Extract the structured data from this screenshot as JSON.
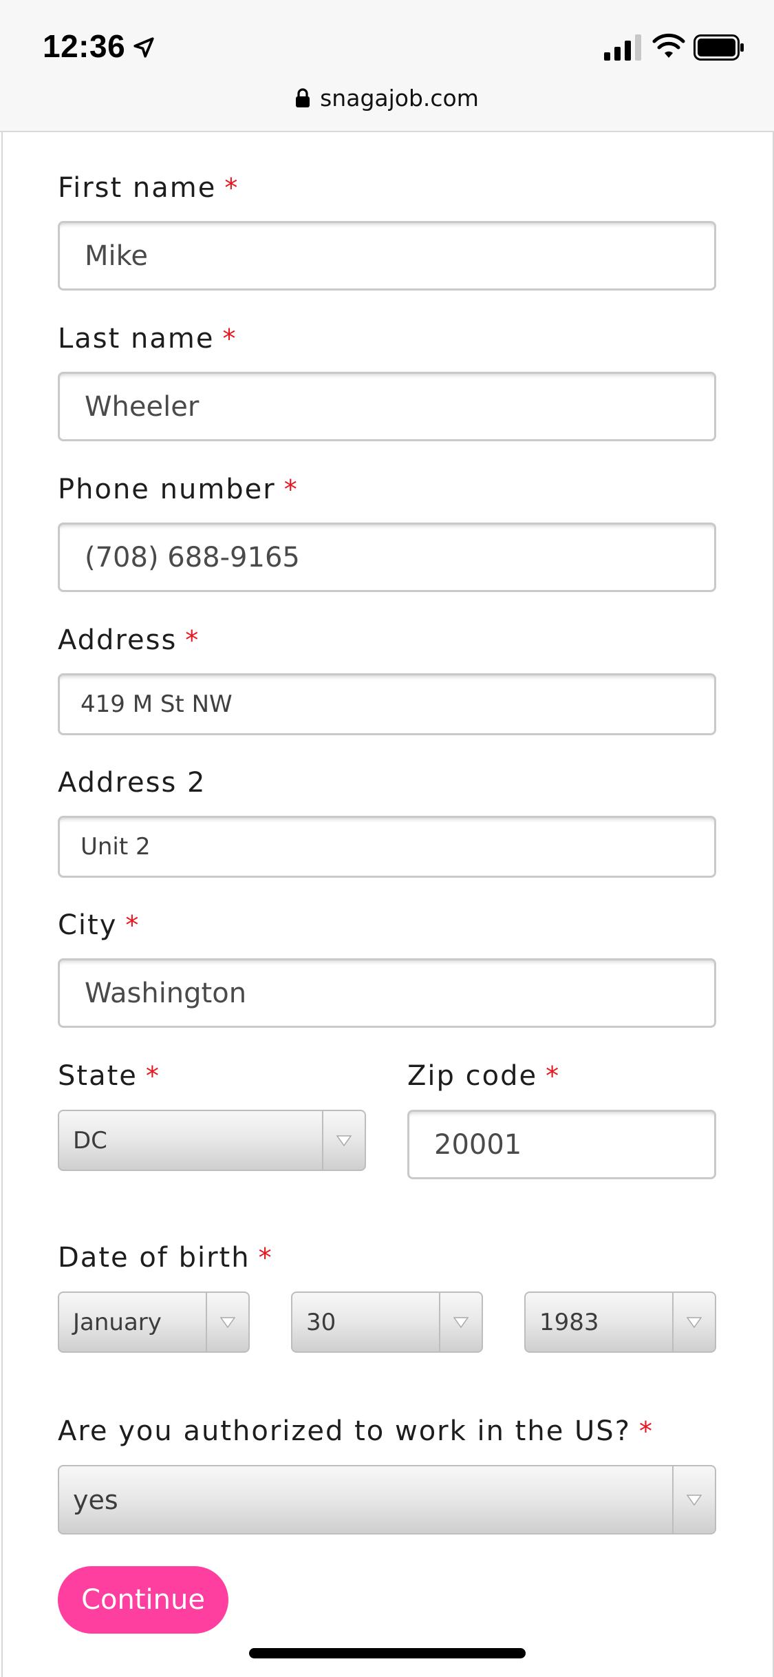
{
  "status_bar": {
    "time": "12:36",
    "url": "snagajob.com"
  },
  "form": {
    "first_name": {
      "label": "First name",
      "required_mark": "*",
      "value": "Mike"
    },
    "last_name": {
      "label": "Last name",
      "required_mark": "*",
      "value": "Wheeler"
    },
    "phone": {
      "label": "Phone number",
      "required_mark": "*",
      "value": "(708) 688-9165"
    },
    "address": {
      "label": "Address",
      "required_mark": "*",
      "value": "419 M St NW"
    },
    "address2": {
      "label": "Address 2",
      "value": "Unit 2"
    },
    "city": {
      "label": "City",
      "required_mark": "*",
      "value": "Washington"
    },
    "state": {
      "label": "State",
      "required_mark": "*",
      "selected": "DC"
    },
    "zip": {
      "label": "Zip code",
      "required_mark": "*",
      "value": "20001"
    },
    "dob": {
      "label": "Date of birth",
      "required_mark": "*",
      "month": "January",
      "day": "30",
      "year": "1983"
    },
    "work_auth": {
      "label": "Are you authorized to work in the US?",
      "required_mark": "*",
      "selected": "yes"
    },
    "continue_label": "Continue"
  },
  "colors": {
    "accent": "#ff3fa0",
    "required": "#e8161e"
  },
  "icons": [
    "location-arrow-icon",
    "signal-icon",
    "wifi-icon",
    "battery-icon",
    "lock-icon",
    "chevron-down-icon"
  ]
}
